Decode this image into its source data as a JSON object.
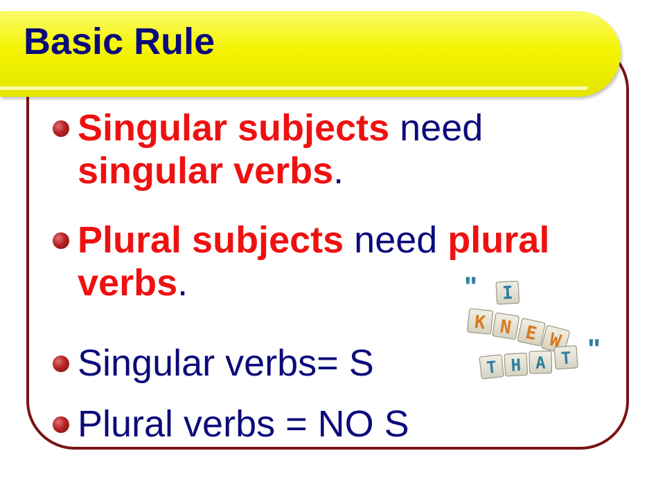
{
  "slide": {
    "title": "Basic Rule",
    "bullets": [
      {
        "red_a": "Singular subjects",
        "plain_a": " need ",
        "red_b": "singular verbs",
        "plain_b": "."
      },
      {
        "red_a": "Plural subjects",
        "plain_a": " need ",
        "red_b": "plural verbs",
        "plain_b": "."
      },
      {
        "text": "Singular verbs= S"
      },
      {
        "text": "Plural verbs = NO S"
      }
    ],
    "picture": {
      "open_quote": "\"",
      "close_quote": "\"",
      "row1": "I",
      "row2": [
        "K",
        "N",
        "E",
        "W"
      ],
      "row3": [
        "T",
        "H",
        "A",
        "T"
      ]
    }
  },
  "colors": {
    "title_bar": "#f4f400",
    "title_text": "#0b0b7a",
    "frame": "#7a1414",
    "emphasis": "#ee1111",
    "body_text": "#0b0b7a",
    "bullet": "#b52222"
  }
}
